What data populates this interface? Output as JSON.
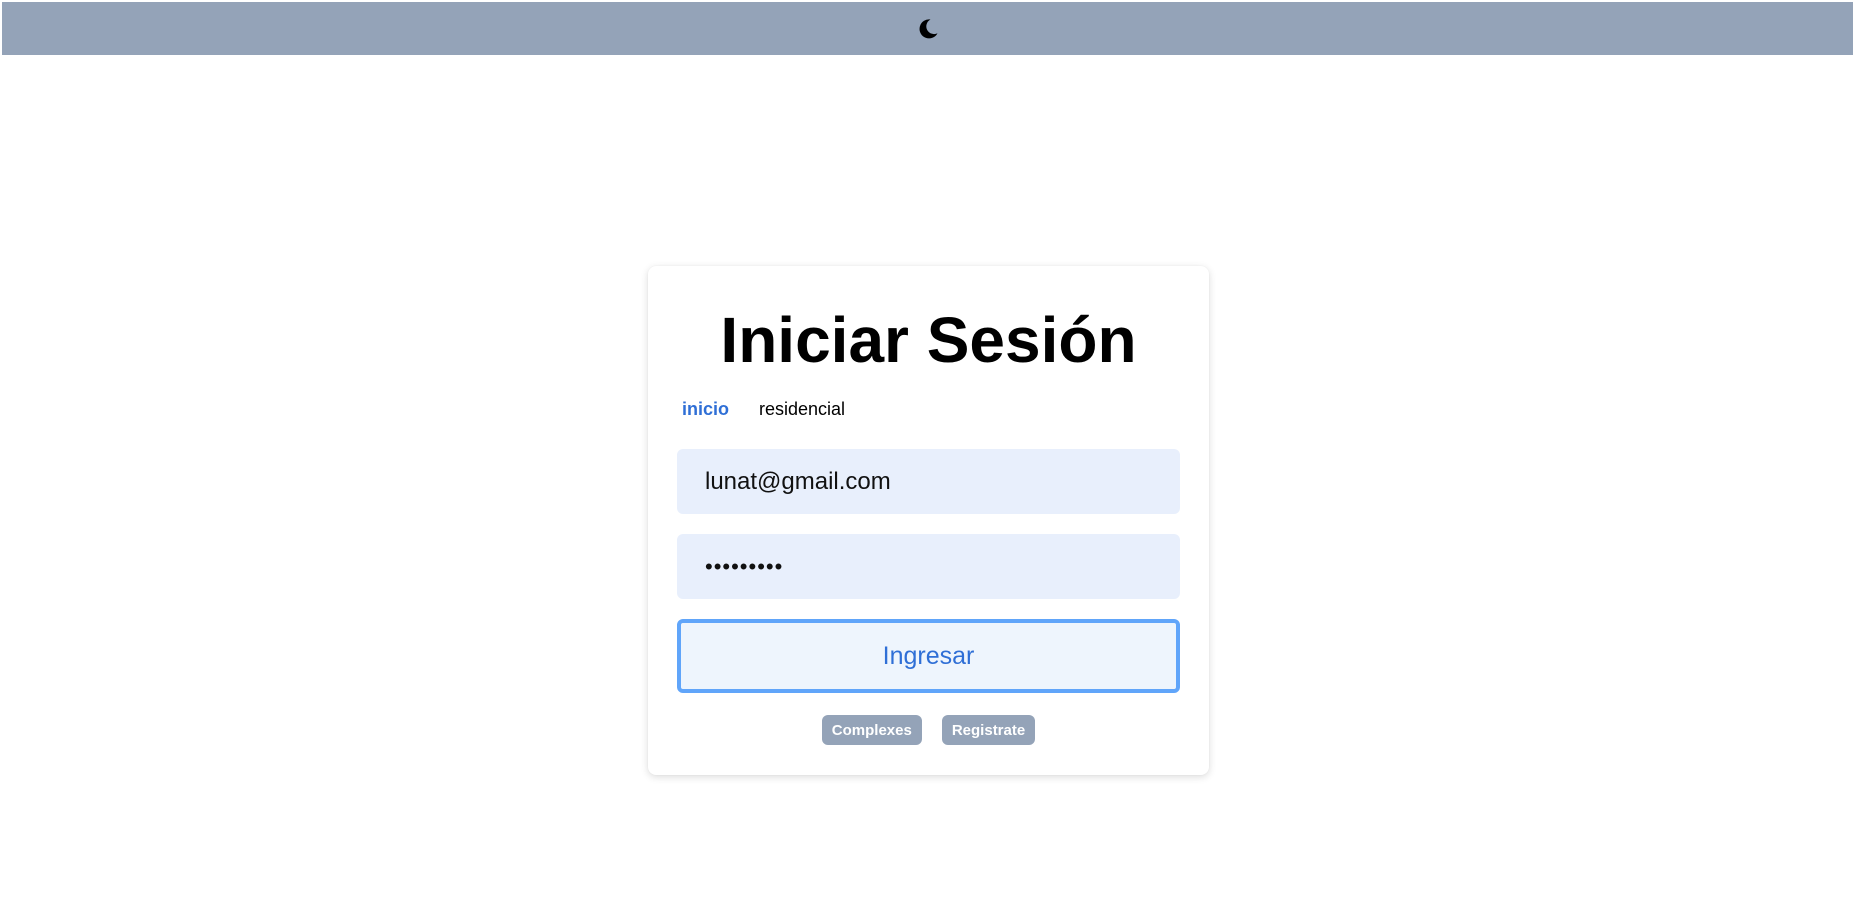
{
  "topbar": {
    "theme_toggle_icon": "moon-icon",
    "background": "#94a3b8"
  },
  "login": {
    "title": "Iniciar Sesión",
    "tabs": [
      {
        "label": "inicio",
        "active": true
      },
      {
        "label": "residencial",
        "active": false
      }
    ],
    "email": {
      "value": "lunat@gmail.com"
    },
    "password": {
      "value": "•••••••••"
    },
    "submit_label": "Ingresar",
    "links": [
      {
        "label": "Complexes"
      },
      {
        "label": "Registrate"
      }
    ]
  },
  "colors": {
    "accent": "#2f6fd6",
    "focus_border": "#60a5fa",
    "field_background": "#e8effc",
    "secondary_button": "#94a3b8"
  }
}
